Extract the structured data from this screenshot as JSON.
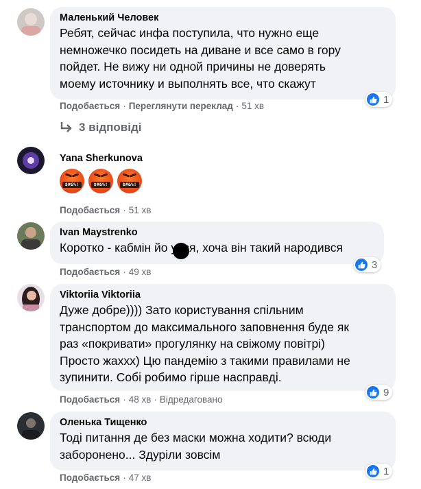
{
  "comments": [
    {
      "author": "Маленький Человек",
      "lines": [
        "Ребят, сейчас инфа поступила, что нужно еще",
        "немножечко посидеть на диване и все само в гору",
        "пойдет. Не вижу ни одной причины не доверять",
        "моему источнику и выполнять все, что скажут"
      ],
      "like": "Подобається",
      "translate": "Переглянути переклад",
      "time": "51 хв",
      "reaction_count": "1",
      "replies": "3 відповіді"
    },
    {
      "author": "Yana Sherkunova",
      "emoji_text": "$#&%!",
      "like": "Подобається",
      "time": "51 хв"
    },
    {
      "author": "Ivan Maystrenko",
      "lines": [
        "Коротко - кабмін йо  увся, хоча він такий народився"
      ],
      "like": "Подобається",
      "time": "49 хв",
      "reaction_count": "3"
    },
    {
      "author": "Viktoriia Viktoriia",
      "lines": [
        "Дуже добре)))) Зато користування спільним",
        "транспортом до максимального заповнення буде як",
        "раз «покривати» прогулянку на свіжому повітрі)",
        "Просто жаххх) Цю пандемію з такими правилами не",
        "зупинити. Собі робимо гірше насправді."
      ],
      "like": "Подобається",
      "time": "48 хв",
      "edited": "Відредаговано",
      "reaction_count": "9"
    },
    {
      "author": "Оленька Тищенко",
      "lines": [
        "Тоді питання де без маски можна ходити? всюди",
        "заборонено... Здуріли зовсім"
      ],
      "like": "Подобається",
      "time": "47 хв",
      "reaction_count": "1"
    }
  ],
  "colors": {
    "bubble": "#f0f2f5",
    "meta": "#65676b",
    "like_blue": "#1877f2"
  },
  "icons": [
    "like-icon",
    "reply-arrow-icon"
  ]
}
